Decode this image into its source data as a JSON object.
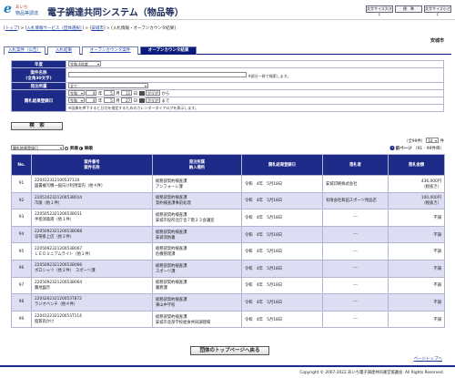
{
  "header": {
    "logo_mark": "e",
    "logo_line1": "あいち",
    "logo_line2": "物品等調達",
    "system_name": "電子調達共同システム（物品等）",
    "buttons": [
      "文字サイズ大きく",
      "標　準",
      "文字サイズ小さく"
    ]
  },
  "breadcrumb": {
    "items": [
      "トップ",
      "入札情報サービス（団体選択）",
      "安城市",
      "入札情報・オープンカウンタ結果"
    ],
    "separator": ">"
  },
  "city": "安城市",
  "tabs": [
    "入札案件（公告）",
    "入札結果",
    "オープンカウンタ案件",
    "オープンカウンタ結果"
  ],
  "form": {
    "fiscal_year_label": "年度",
    "fiscal_year_value": "令和 4年度",
    "case_name_label": "案件名称",
    "case_name_sub": "(全角30文字)",
    "case_name_note": "※部分一致で検索します。",
    "dept_label": "発注所属",
    "dept_value": "全て",
    "date_label": "開札結果登録日",
    "era1": "令和",
    "from_year": "4",
    "from_month": "5",
    "from_day": "11",
    "era2": "令和",
    "to_year": "4",
    "to_month": "5",
    "to_day": "27",
    "unit_year": "年",
    "unit_month": "月",
    "unit_day": "日",
    "clear_label": "クリア",
    "from_suffix": "から",
    "to_suffix": "まで",
    "date_note": "※画像を押下すると日付を指定するためのカレンダーダイアログを表示します。",
    "search_label": "検　索"
  },
  "sort": {
    "field": "開札結果登録日",
    "asc_label": "昇順",
    "desc_label": "降順"
  },
  "pager": {
    "total": "（全99件）",
    "per_page": "10",
    "per_page_unit": "件",
    "prev_label": "前ページ",
    "range": "（91 - 99件目）"
  },
  "table": {
    "headers": [
      "No.",
      "案件番号\n案件名称",
      "発注所属\n納入場所",
      "開札結果登録日",
      "落札者",
      "落札金額"
    ],
    "rows": [
      {
        "no": "91",
        "id": "220412312100537110",
        "name": "図書複写機一般向け利用案内（他４件）",
        "dept": "総務部契約検査課",
        "place": "アンフォーレ課",
        "date": "令和　4年　5月18日",
        "winner": "安城印刷株式会社",
        "amount": "436,000円",
        "tax": "（税抜き）"
      },
      {
        "no": "92",
        "id": "220510232120053B014",
        "name": "市旗（他１件）",
        "dept": "総務部契約検査課",
        "place": "契約検査課事前処理",
        "date": "令和　4年　5月18日",
        "winner": "有限会社和田スポーツ用品店",
        "amount": "100,000円",
        "tax": "（税抜き）"
      },
      {
        "no": "93",
        "id": "220505232120053B011",
        "name": "手指消毒液（他１件）",
        "dept": "総務部契約検査課",
        "place": "安城市役所北庁舎７階２３会議室",
        "date": "令和　4年　5月18日",
        "winner": "---",
        "amount": "不調",
        "tax": ""
      },
      {
        "no": "94",
        "id": "220509232120053B068",
        "name": "涼帯掛上店（他２件）",
        "dept": "総務部契約検査課",
        "place": "安城消防署",
        "date": "令和　4年　5月18日",
        "winner": "---",
        "amount": "不調",
        "tax": ""
      },
      {
        "no": "95",
        "id": "220509232120053B067",
        "name": "ＬＥＤミニアムライト（他１件）",
        "dept": "総務部契約検査課",
        "place": "危機管理課",
        "date": "令和　4年　5月18日",
        "winner": "---",
        "amount": "不調",
        "tax": ""
      },
      {
        "no": "96",
        "id": "220509232120053B066",
        "name": "ボロシャツ（他２件）　スポーツ課",
        "dept": "総務部契約検査課",
        "place": "スポーツ課",
        "date": "令和　4年　5月18日",
        "winner": "---",
        "amount": "不調",
        "tax": ""
      },
      {
        "no": "97",
        "id": "220509232120053B064",
        "name": "農地図示",
        "dept": "総務部契約検査課",
        "place": "農務課",
        "date": "令和　4年　5月18日",
        "winner": "---",
        "amount": "不調",
        "tax": ""
      },
      {
        "no": "98",
        "id": "220426232120053T872",
        "name": "ラジオペンチ（他４件）",
        "dept": "総務部契約検査課",
        "place": "東山中学校",
        "date": "令和　4年　5月18日",
        "winner": "---",
        "amount": "不調",
        "tax": ""
      },
      {
        "no": "99",
        "id": "220412232120053T114",
        "name": "脂質肉かけ",
        "dept": "総務部契約検査課",
        "place": "安城市北部学校給食共同調理場",
        "date": "令和　4年　5月18日",
        "winner": "---",
        "amount": "不調",
        "tax": ""
      }
    ]
  },
  "back_button": "団体のトップページへ戻る",
  "page_top": "ページトップへ",
  "footer": "Copyright © 2007-2022 あいち電子調達共同運営協議会. All Rights Reserved."
}
